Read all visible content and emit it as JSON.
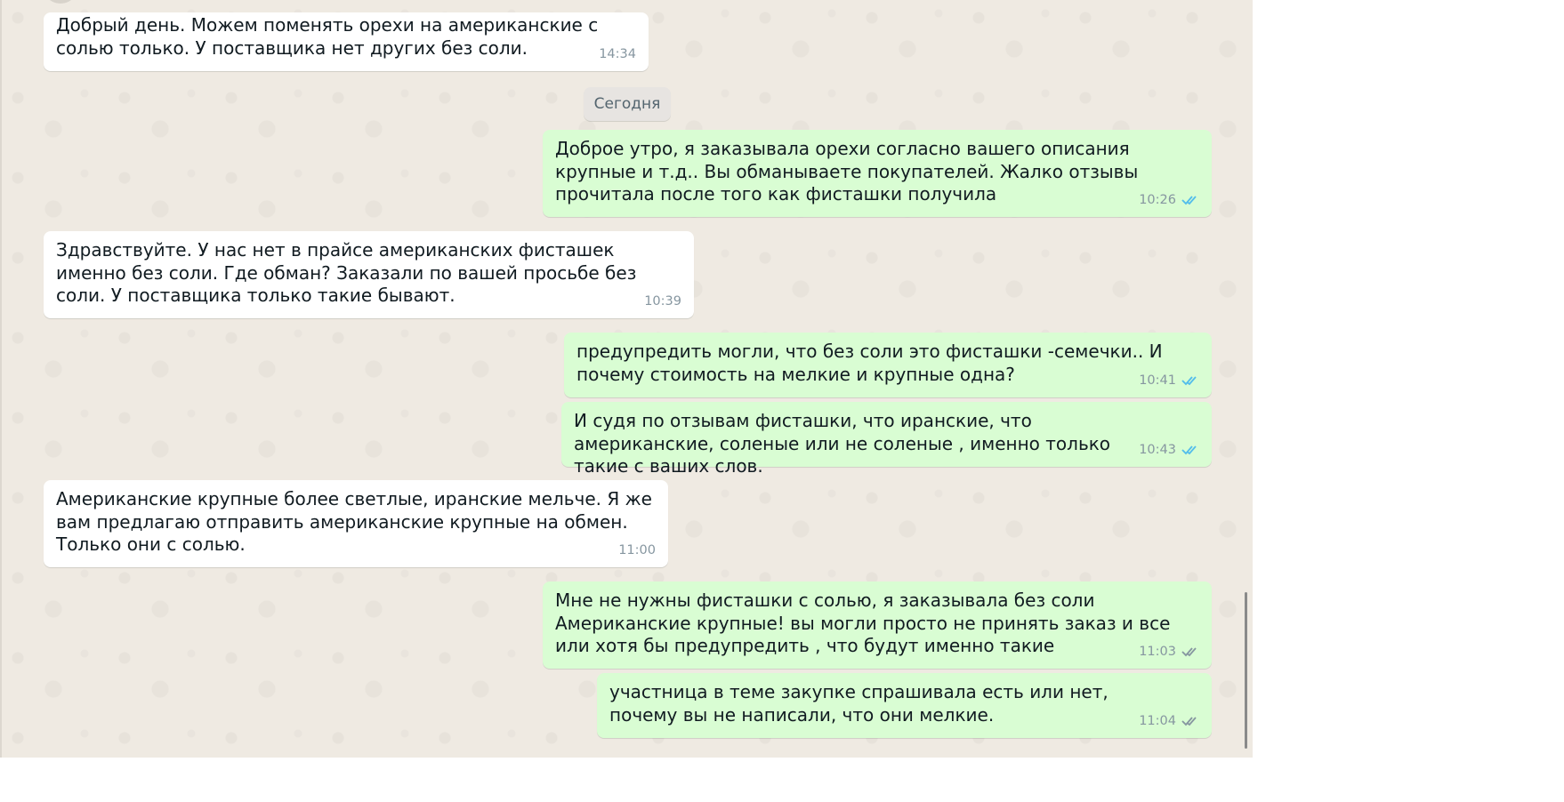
{
  "date_separator": "Сегодня",
  "messages": [
    {
      "text": "Добрый день. Можем поменять орехи на американские с солью только. У поставщика нет других без соли.",
      "time": "14:34"
    },
    {
      "text": "Доброе утро, я заказывала орехи согласно вашего описания крупные и т.д.. Вы обманываете покупателей. Жалко отзывы прочитала после того как фисташки получила",
      "time": "10:26",
      "status": "read"
    },
    {
      "text": "Здравствуйте. У нас нет в прайсе американских фисташек именно без соли. Где обман? Заказали по вашей просьбе без соли. У поставщика только такие бывают.",
      "time": "10:39"
    },
    {
      "text": "предупредить могли, что без соли это фисташки -семечки.. И почему стоимость на мелкие и крупные одна?",
      "time": "10:41",
      "status": "read"
    },
    {
      "text": "И судя по отзывам фисташки, что иранские, что американские, соленые или не соленые , именно только такие с ваших слов.",
      "time": "10:43",
      "status": "read"
    },
    {
      "text": "Американские крупные более светлые, иранские мельче. Я же вам предлагаю отправить американские крупные на обмен.\nТолько они с солью.",
      "time": "11:00"
    },
    {
      "text": "Мне не нужны фисташки с солью, я заказывала без соли Американские крупные! вы могли просто не принять заказ и все или хотя бы предупредить , что будут именно такие",
      "time": "11:03",
      "status": "delivered"
    },
    {
      "text": "участница в теме закупке спрашивала есть или нет, почему вы не написали, что они мелкие.",
      "time": "11:04",
      "status": "delivered"
    }
  ],
  "colors": {
    "read_tick": "#53bdeb",
    "delivered_tick": "#8696a0",
    "outgoing_bg": "#d9fdd3",
    "incoming_bg": "#ffffff"
  },
  "icons": {
    "read": "double-check-icon",
    "delivered": "double-check-icon"
  }
}
